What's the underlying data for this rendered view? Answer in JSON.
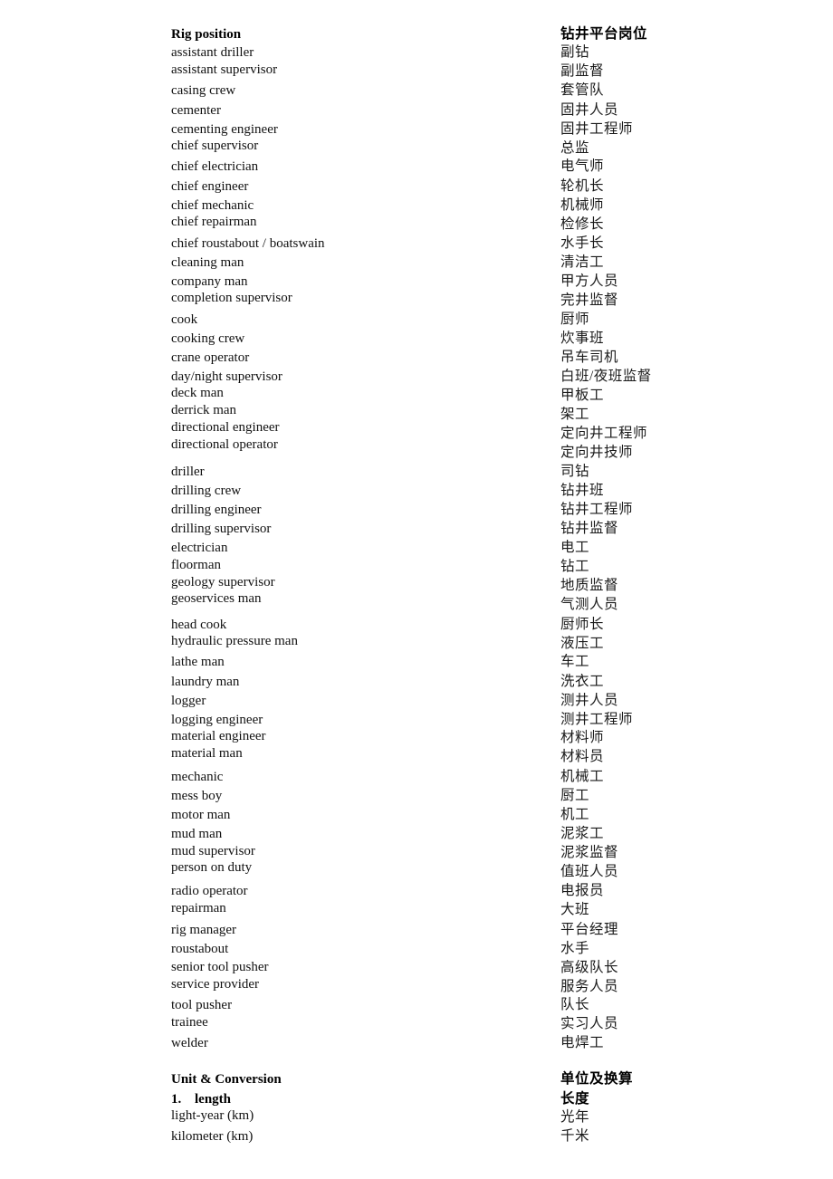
{
  "sections": [
    {
      "heading_en": "Rig position",
      "heading_zh": "钻井平台岗位",
      "entries": [
        {
          "en": "assistant driller",
          "zh": "副钻"
        },
        {
          "en": "assistant supervisor",
          "zh": "副监督"
        },
        {
          "en": "casing crew",
          "zh": "套管队"
        },
        {
          "en": "cementer",
          "zh": "固井人员"
        },
        {
          "en": "cementing engineer",
          "zh": "固井工程师"
        },
        {
          "en": "chief supervisor",
          "zh": "总监"
        },
        {
          "en": "chief electrician",
          "zh": "电气师"
        },
        {
          "en": "chief engineer",
          "zh": "轮机长"
        },
        {
          "en": "chief mechanic",
          "zh": "机械师"
        },
        {
          "en": "chief repairman",
          "zh": "检修长"
        },
        {
          "en": "chief roustabout / boatswain",
          "zh": "水手长"
        },
        {
          "en": "cleaning man",
          "zh": "清洁工"
        },
        {
          "en": "company man",
          "zh": "甲方人员"
        },
        {
          "en": "completion supervisor",
          "zh": "完井监督"
        },
        {
          "en": "cook",
          "zh": "厨师"
        },
        {
          "en": "cooking crew",
          "zh": "炊事班"
        },
        {
          "en": "crane operator",
          "zh": "吊车司机"
        },
        {
          "en": "day/night supervisor",
          "zh": "白班/夜班监督"
        },
        {
          "en": "deck man",
          "zh": "甲板工"
        },
        {
          "en": "derrick man",
          "zh": "架工"
        },
        {
          "en": "directional engineer",
          "zh": "定向井工程师"
        },
        {
          "en": "directional operator",
          "zh": "定向井技师"
        },
        {
          "en": "driller",
          "zh": "司钻"
        },
        {
          "en": "drilling crew",
          "zh": "钻井班"
        },
        {
          "en": "drilling engineer",
          "zh": "钻井工程师"
        },
        {
          "en": "drilling supervisor",
          "zh": "钻井监督"
        },
        {
          "en": "electrician",
          "zh": "电工"
        },
        {
          "en": "floorman",
          "zh": "钻工"
        },
        {
          "en": "geology supervisor",
          "zh": "地质监督"
        },
        {
          "en": "geoservices man",
          "zh": "气测人员"
        },
        {
          "en": "head cook",
          "zh": "厨师长"
        },
        {
          "en": "hydraulic pressure man",
          "zh": "液压工"
        },
        {
          "en": "lathe man",
          "zh": "车工"
        },
        {
          "en": "laundry man",
          "zh": "洗衣工"
        },
        {
          "en": "logger",
          "zh": "测井人员"
        },
        {
          "en": "logging engineer",
          "zh": "测井工程师"
        },
        {
          "en": "material engineer",
          "zh": "材料师"
        },
        {
          "en": "material man",
          "zh": "材料员"
        },
        {
          "en": "mechanic",
          "zh": "机械工"
        },
        {
          "en": "mess boy",
          "zh": "厨工"
        },
        {
          "en": "motor man",
          "zh": "机工"
        },
        {
          "en": "mud man",
          "zh": "泥浆工"
        },
        {
          "en": "mud supervisor",
          "zh": "泥浆监督"
        },
        {
          "en": "person on duty",
          "zh": "值班人员"
        },
        {
          "en": "radio operator",
          "zh": "电报员"
        },
        {
          "en": "repairman",
          "zh": "大班"
        },
        {
          "en": "rig manager",
          "zh": "平台经理"
        },
        {
          "en": "roustabout",
          "zh": "水手"
        },
        {
          "en": "senior tool pusher",
          "zh": "高级队长"
        },
        {
          "en": "service provider",
          "zh": "服务人员"
        },
        {
          "en": "tool pusher",
          "zh": "队长"
        },
        {
          "en": "trainee",
          "zh": "实习人员"
        },
        {
          "en": "welder",
          "zh": "电焊工"
        }
      ]
    },
    {
      "heading_en": "Unit & Conversion",
      "heading_zh": "单位及换算",
      "subsections": [
        {
          "number": "1.",
          "title_en": "length",
          "title_zh": "长度",
          "entries": [
            {
              "en": "light-year (km)",
              "zh": "光年"
            },
            {
              "en": "kilometer (km)",
              "zh": "千米"
            }
          ]
        }
      ]
    }
  ]
}
